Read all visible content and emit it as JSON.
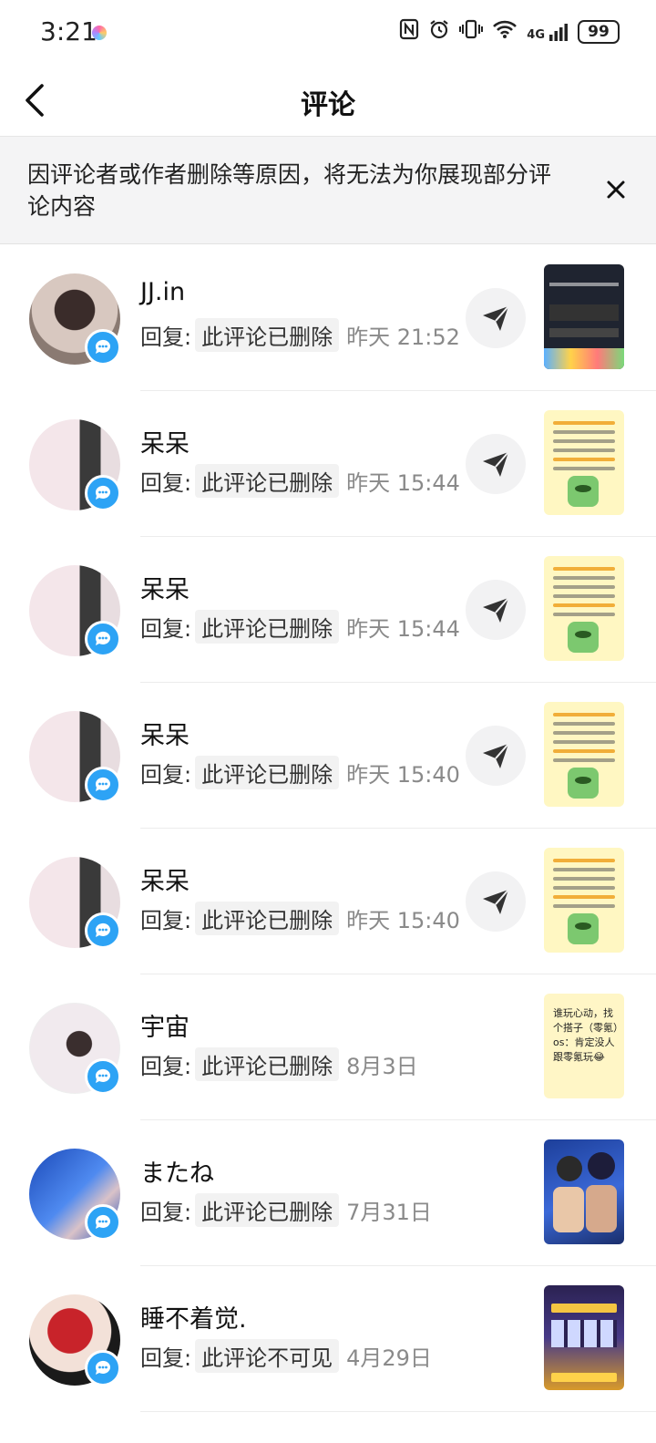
{
  "status_bar": {
    "time": "3:21",
    "signal": "4G",
    "battery": "99"
  },
  "header": {
    "title": "评论"
  },
  "notice": {
    "text": "因评论者或作者删除等原因，将无法为你展现部分评论内容"
  },
  "reply_label": "回复:",
  "comments": [
    {
      "username": "JJ.in",
      "reply_text": "此评论已删除",
      "time": "昨天 21:52"
    },
    {
      "username": "呆呆",
      "reply_text": "此评论已删除",
      "time": "昨天 15:44"
    },
    {
      "username": "呆呆",
      "reply_text": "此评论已删除",
      "time": "昨天 15:44"
    },
    {
      "username": "呆呆",
      "reply_text": "此评论已删除",
      "time": "昨天 15:40"
    },
    {
      "username": "呆呆",
      "reply_text": "此评论已删除",
      "time": "昨天 15:40"
    },
    {
      "username": "宇宙",
      "reply_text": "此评论已删除",
      "time": "8月3日"
    },
    {
      "username": "またね",
      "reply_text": "此评论已删除",
      "time": "7月31日"
    },
    {
      "username": "睡不着觉.",
      "reply_text": "此评论不可见",
      "time": "4月29日"
    }
  ],
  "thumbnail_text": "谁玩心动，找个搭子（零氪）os：肯定没人跟零氪玩😂",
  "colors": {
    "badge_blue": "#2da3f5",
    "notice_bg": "#f4f4f5",
    "time_gray": "#8a8a8a"
  }
}
